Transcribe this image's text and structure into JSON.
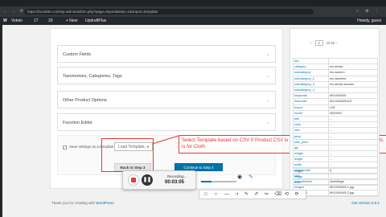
{
  "browser": {
    "url": "https://localsite.com/wp-admin/admin.php?page=import&step=1&import=template",
    "nav_icons": "← → ⟳",
    "extension_icons": "☆ ⚙ ⋮"
  },
  "adminbar": {
    "wp_logo": "W",
    "site_name": "Votelo",
    "updates_count": "17",
    "comments_count": "33",
    "new_label": "+ New",
    "plugin_label": "UpdraftPlus",
    "howdy": "Howdy, guest"
  },
  "sections": [
    {
      "label": "Custom Fields"
    },
    {
      "label": "Taxonomies, Categories, Tags"
    },
    {
      "label": "Other Product Options"
    },
    {
      "label": "Function Editor"
    }
  ],
  "save_template": {
    "checkbox_label": "Save settings as a template",
    "select_value": "Load Template..."
  },
  "buttons": {
    "back": "Back to Step 3",
    "continue": "Continue to Step 4"
  },
  "annotation": {
    "text": "Select Template based on CSV If Product CSV is for Shoes Select Shoes Or If CSV products is for Cloth"
  },
  "right_panel": {
    "page_current": "1",
    "page_total": "of 10",
    "rows": [
      {
        "key": "sku",
        "value": ""
      },
      {
        "key": "category",
        "value": "mv-shoes"
      },
      {
        "key": "subcategory",
        "value": "mv-women"
      },
      {
        "key": "subcategory_2",
        "value": "mv-wheelee"
      },
      {
        "key": "subcategory_3",
        "value": "mv-shoes-women"
      },
      {
        "key": "subcategory_4",
        "value": ""
      },
      {
        "key": "keywords",
        "value": "MV1004345"
      },
      {
        "key": "itemcode",
        "value": "MV1004345VLE"
      },
      {
        "key": "brand",
        "value": "LVE"
      },
      {
        "key": "model",
        "value": "0000000"
      },
      {
        "key": "title",
        "value": "..."
      },
      {
        "key": "color",
        "value": "..."
      },
      {
        "key": "size",
        "value": "..."
      },
      {
        "key": "price",
        "value": "..."
      },
      {
        "key": "sale_price",
        "value": "..."
      },
      {
        "key": "qty",
        "value": "..."
      },
      {
        "key": "weight",
        "value": "..."
      },
      {
        "key": "length",
        "value": "..."
      },
      {
        "key": "width",
        "value": "..."
      },
      {
        "key": "height",
        "value": "..."
      },
      {
        "key": "image",
        "value": "..."
      },
      {
        "key": "desc",
        "value": "..."
      }
    ],
    "bottom_rows": [
      {
        "key": "shippanrate",
        "value": "0"
      },
      {
        "key": "size",
        "value": ""
      },
      {
        "key": "manufacturer",
        "value": "Hushlinger"
      },
      {
        "key": "images",
        "value": "MV1004345-1.jpg"
      },
      {
        "key": "images_2",
        "value": "MV1004345-2.jpg"
      }
    ]
  },
  "recording": {
    "status": "Recording...",
    "time": "00:03:05",
    "pause_icon": "❚❚",
    "progress": 0.3
  },
  "cam_tools": {
    "target_icon": "◉",
    "pen_icon": "✎"
  },
  "draw_tools": [
    "□",
    "○",
    "—",
    "➝",
    "✎",
    "✐",
    "✏",
    "⌫",
    "⟲",
    "⟳"
  ],
  "footer": {
    "thanks_prefix": "Thank you for creating with",
    "thanks_link": "WordPress.",
    "version": "Get Version 5.8.1"
  }
}
